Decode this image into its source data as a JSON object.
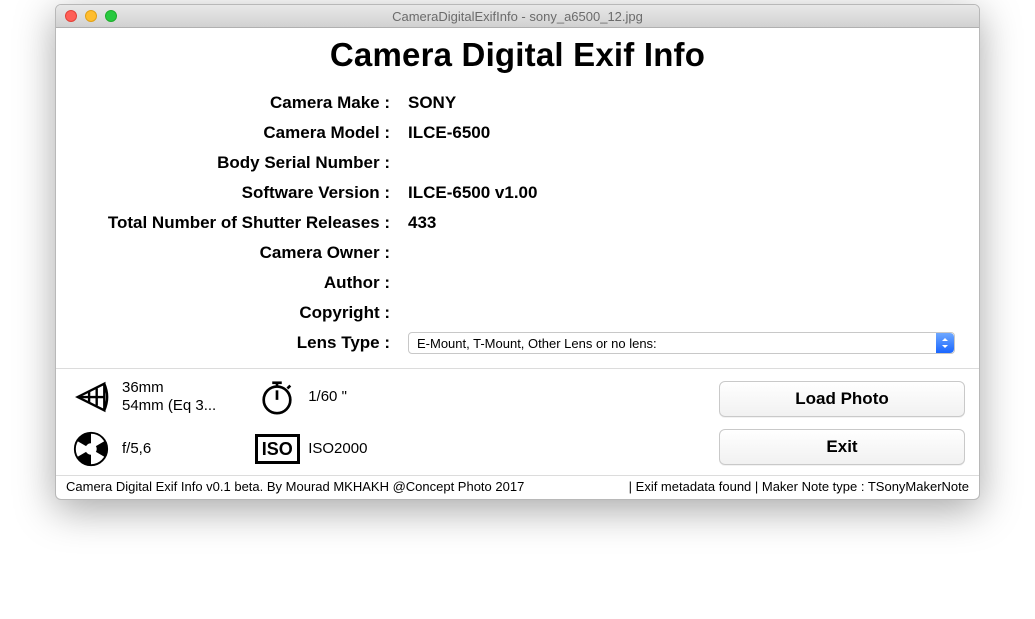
{
  "window": {
    "title": "CameraDigitalExifInfo - sony_a6500_12.jpg"
  },
  "app": {
    "title": "Camera Digital Exif Info"
  },
  "rows": {
    "camera_make": {
      "label": "Camera Make :",
      "value": "SONY"
    },
    "camera_model": {
      "label": "Camera Model :",
      "value": "ILCE-6500"
    },
    "body_serial": {
      "label": "Body Serial Number :",
      "value": ""
    },
    "software": {
      "label": "Software Version :",
      "value": "ILCE-6500 v1.00"
    },
    "shutter_releases": {
      "label": "Total Number of Shutter Releases :",
      "value": "433"
    },
    "camera_owner": {
      "label": "Camera Owner :",
      "value": ""
    },
    "author": {
      "label": "Author :",
      "value": ""
    },
    "copyright": {
      "label": "Copyright :",
      "value": ""
    },
    "lens_type": {
      "label": "Lens Type :",
      "value": "E-Mount, T-Mount, Other Lens or no lens:"
    }
  },
  "summary": {
    "focal_mm": "36mm",
    "focal_eq": "54mm (Eq 3...",
    "aperture": "f/5,6",
    "shutter": "1/60 \"",
    "iso_badge": "ISO",
    "iso_value": "ISO2000"
  },
  "buttons": {
    "load": "Load Photo",
    "exit": "Exit"
  },
  "status": {
    "left": "Camera Digital Exif Info v0.1 beta. By Mourad MKHAKH @Concept Photo 2017",
    "right": "| Exif metadata found | Maker Note type : TSonyMakerNote"
  }
}
